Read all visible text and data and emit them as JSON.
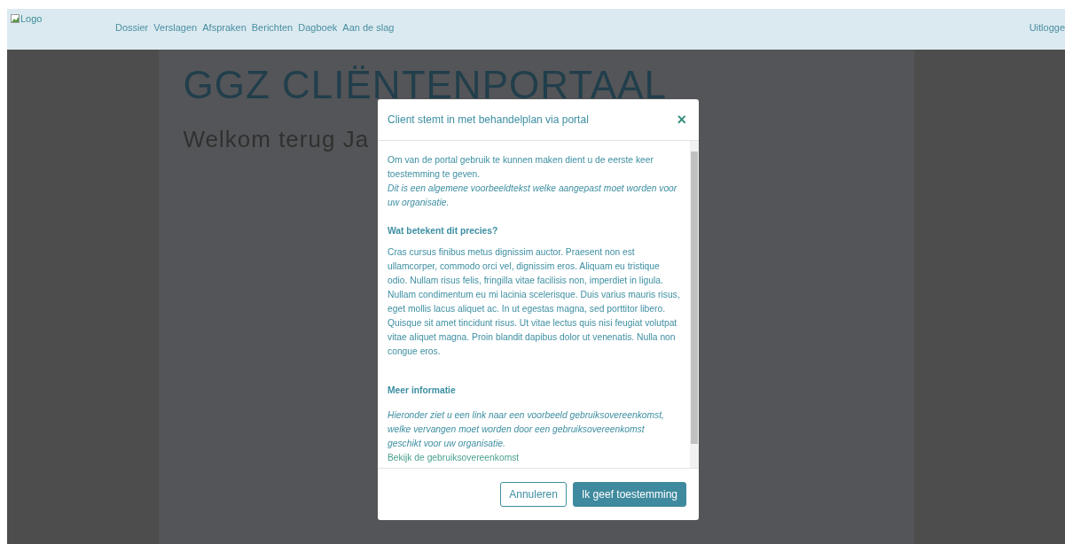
{
  "header": {
    "logo_alt": "Logo",
    "nav": [
      {
        "label": "Dossier"
      },
      {
        "label": "Verslagen"
      },
      {
        "label": "Afspraken"
      },
      {
        "label": "Berichten"
      },
      {
        "label": "Dagboek"
      },
      {
        "label": "Aan de slag"
      }
    ],
    "logout": "Uitlogge"
  },
  "page": {
    "title": "GGZ CLIËNTENPORTAAL",
    "welcome": "Welkom terug Ja"
  },
  "modal": {
    "title": "Client stemt in met behandelplan via portal",
    "close": "×",
    "blocks": [
      {
        "kind": "text",
        "text": "Om van de portal gebruik te kunnen maken dient u de eerste keer toestemming te geven."
      },
      {
        "kind": "italic",
        "text": "Dit is een algemene voorbeeldtekst welke aangepast moet worden voor uw organisatie."
      },
      {
        "kind": "heading",
        "text": "Wat betekent dit precies?"
      },
      {
        "kind": "text",
        "text": "Cras cursus finibus metus dignissim auctor. Praesent non est ullamcorper, commodo orci vel, dignissim eros. Aliquam eu tristique odio. Nullam risus felis, fringilla vitae facilisis non, imperdiet in ligula. Nullam condimentum eu mi lacinia scelerisque. Duis varius mauris risus, eget mollis lacus aliquet ac. In ut egestas magna, sed porttitor libero. Quisque sit amet tincidunt risus. Ut vitae lectus quis nisi feugiat volutpat vitae aliquet magna. Proin blandit dapibus dolor ut venenatis. Nulla non congue eros."
      },
      {
        "kind": "heading",
        "text": "Meer informatie"
      },
      {
        "kind": "italic",
        "text": "Hieronder ziet u een link naar een voorbeeld gebruiksovereenkomst, welke vervangen moet worden door een gebruiksovereenkomst geschikt voor uw organisatie."
      },
      {
        "kind": "link",
        "text": "Bekijk de gebruiksovereenkomst"
      }
    ],
    "buttons": [
      {
        "kind": "secondary",
        "label": "Annuleren"
      },
      {
        "kind": "primary",
        "label": "Ik geef toestemming"
      }
    ]
  }
}
